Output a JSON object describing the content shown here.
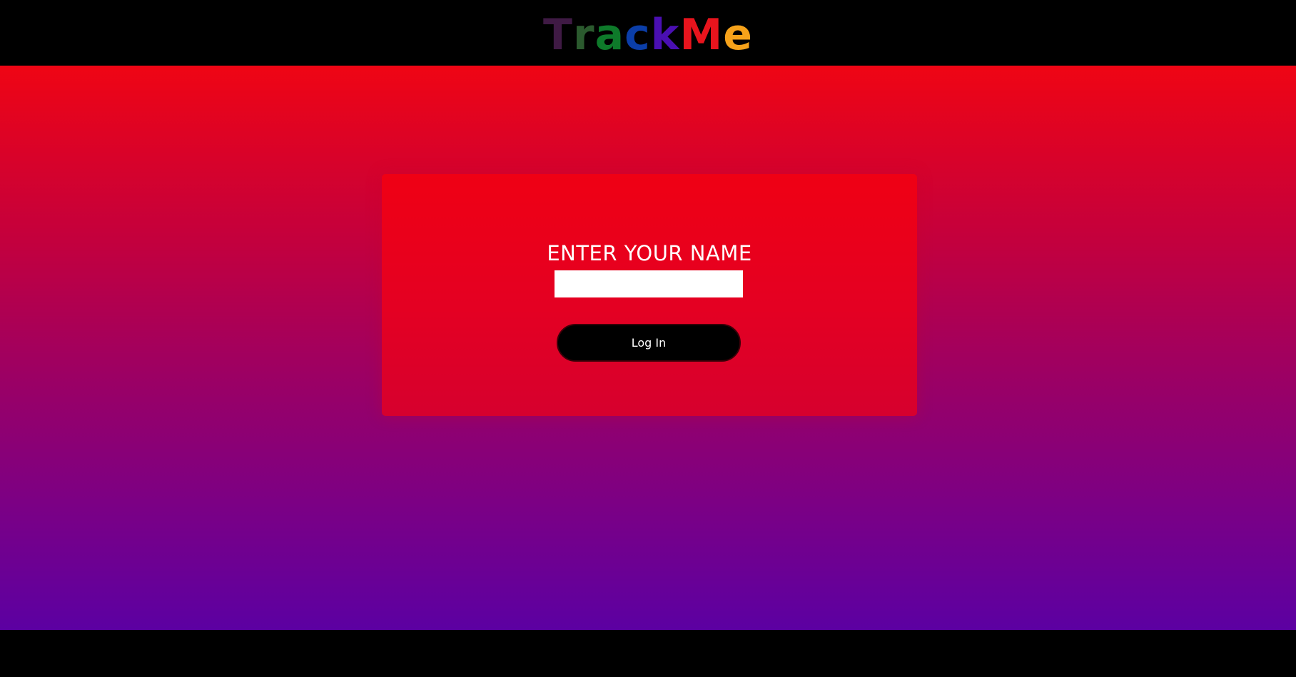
{
  "header": {
    "logo": {
      "letters": [
        {
          "char": "T",
          "color": "#3f1a44"
        },
        {
          "char": "r",
          "color": "#2b5a2e"
        },
        {
          "char": "a",
          "color": "#0e7a2a"
        },
        {
          "char": "c",
          "color": "#0b3ea8"
        },
        {
          "char": "k",
          "color": "#4a0fb2"
        },
        {
          "char": "M",
          "color": "#e8141d"
        },
        {
          "char": "e",
          "color": "#f6a21a"
        }
      ]
    }
  },
  "login": {
    "title": "ENTER YOUR NAME",
    "name_input": {
      "value": "",
      "placeholder": ""
    },
    "login_button_label": "Log In"
  },
  "colors": {
    "gradient_top": "#ef0514",
    "gradient_bottom": "#5c00a2",
    "card": "#e40022",
    "bars": "#000000"
  }
}
